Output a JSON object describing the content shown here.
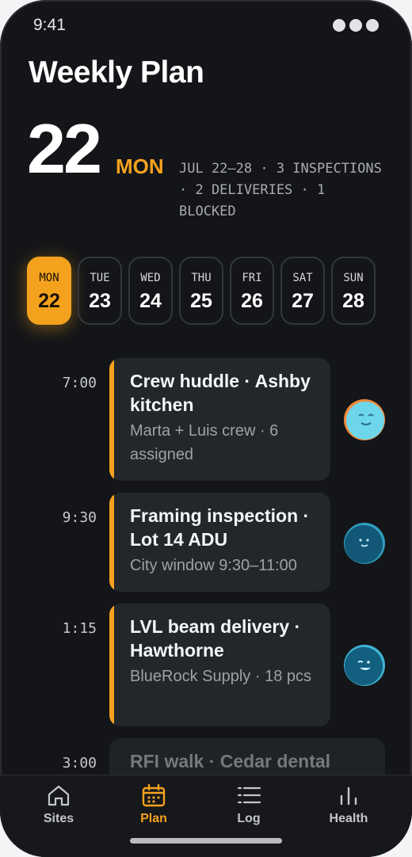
{
  "status": {
    "time": "9:41"
  },
  "header": {
    "title": "Weekly Plan",
    "day_number": "22",
    "day_name": "MON",
    "summary": "JUL 22–28 · 3 INSPECTIONS · 2 DELIVERIES · 1 BLOCKED"
  },
  "week": [
    {
      "label": "MON",
      "num": "22",
      "selected": true
    },
    {
      "label": "TUE",
      "num": "23"
    },
    {
      "label": "WED",
      "num": "24"
    },
    {
      "label": "THU",
      "num": "25"
    },
    {
      "label": "FRI",
      "num": "26"
    },
    {
      "label": "SAT",
      "num": "27"
    },
    {
      "label": "SUN",
      "num": "28"
    }
  ],
  "events": [
    {
      "time": "7:00",
      "title": "Crew huddle · Ashby kitchen",
      "subtitle": "Marta + Luis crew · 6 assigned"
    },
    {
      "time": "9:30",
      "title": "Framing inspection · Lot 14 ADU",
      "subtitle": "City window 9:30–11:00"
    },
    {
      "time": "1:15",
      "title": "LVL beam delivery · Hawthorne",
      "subtitle": "BlueRock Supply · 18 pcs"
    },
    {
      "time": "3:00",
      "title": "RFI walk · Cedar dental"
    }
  ],
  "tabs": [
    {
      "label": "Sites",
      "icon": "home-icon"
    },
    {
      "label": "Plan",
      "icon": "calendar-icon",
      "active": true
    },
    {
      "label": "Log",
      "icon": "list-icon"
    },
    {
      "label": "Health",
      "icon": "bar-chart-icon"
    }
  ],
  "colors": {
    "accent": "#f4a21e",
    "background": "#131518",
    "card": "#23262b"
  }
}
